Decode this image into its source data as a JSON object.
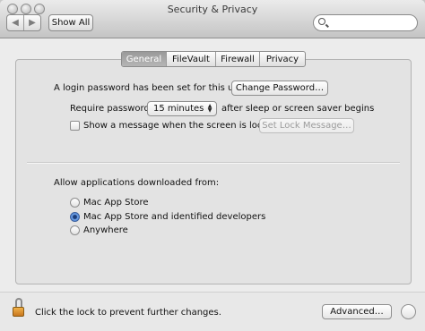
{
  "window": {
    "title": "Security & Privacy"
  },
  "toolbar": {
    "back_glyph": "◀",
    "forward_glyph": "▶",
    "show_all_label": "Show All"
  },
  "search": {
    "value": "",
    "placeholder": ""
  },
  "tabs": [
    {
      "label": "General",
      "active": true
    },
    {
      "label": "FileVault",
      "active": false
    },
    {
      "label": "Firewall",
      "active": false
    },
    {
      "label": "Privacy",
      "active": false
    }
  ],
  "general": {
    "login_password_text": "A login password has been set for this user",
    "change_password_label": "Change Password…",
    "require_password_label": "Require password",
    "require_password_value": "15 minutes",
    "require_password_suffix": "after sleep or screen saver begins",
    "show_message_label": "Show a message when the screen is locked",
    "show_message_checked": false,
    "set_lock_message_label": "Set Lock Message…",
    "allow_apps_heading": "Allow applications downloaded from:",
    "allow_apps_options": [
      {
        "label": "Mac App Store",
        "selected": false
      },
      {
        "label": "Mac App Store and identified developers",
        "selected": true
      },
      {
        "label": "Anywhere",
        "selected": false
      }
    ]
  },
  "footer": {
    "lock_text": "Click the lock to prevent further changes.",
    "advanced_label": "Advanced…",
    "lock_icon": "open-padlock-icon"
  },
  "colors": {
    "active_tab": "#a6a6a6",
    "radio_selected": "#3f78d0",
    "lock": "#e39a35"
  }
}
